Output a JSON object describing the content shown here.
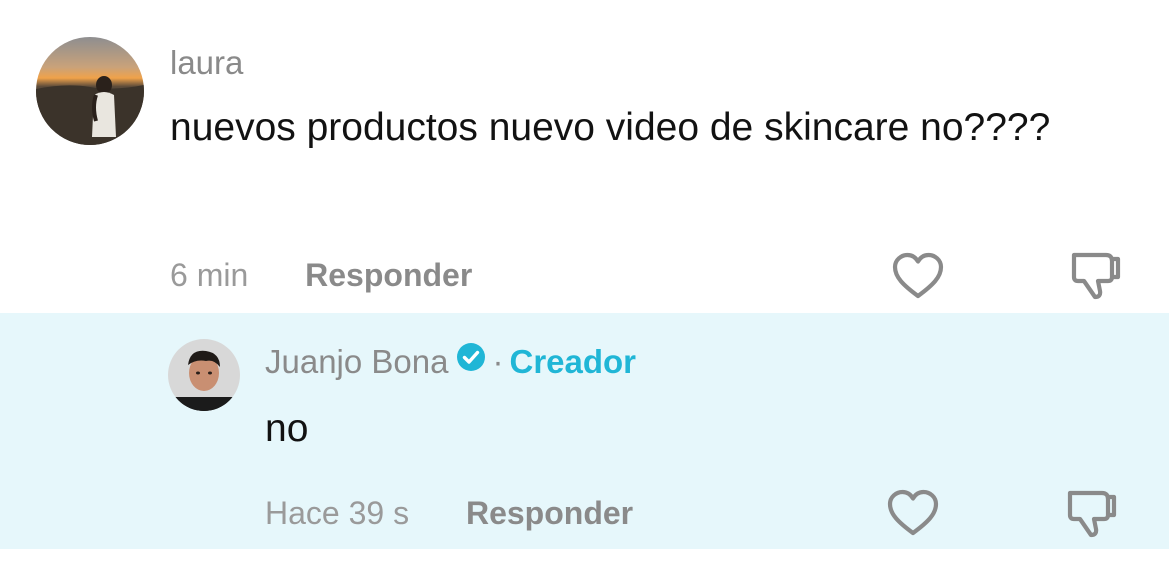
{
  "comments": [
    {
      "username": "laura",
      "text": "nuevos productos nuevo video de skincare no????",
      "time": "6 min",
      "reply_label": "Responder",
      "icons": {
        "like": "heart-icon",
        "dislike": "thumbs-down-icon"
      }
    }
  ],
  "reply": {
    "username": "Juanjo Bona",
    "verified_icon": "verified-check-icon",
    "separator": "·",
    "badge": "Creador",
    "text": "no",
    "time": "Hace 39 s",
    "reply_label": "Responder",
    "icons": {
      "like": "heart-icon",
      "dislike": "thumbs-down-icon"
    }
  },
  "colors": {
    "reply_background": "#e6f7fb",
    "creator_accent": "#20b6d6",
    "muted_text": "#8a8a8a",
    "body_text": "#121212"
  }
}
